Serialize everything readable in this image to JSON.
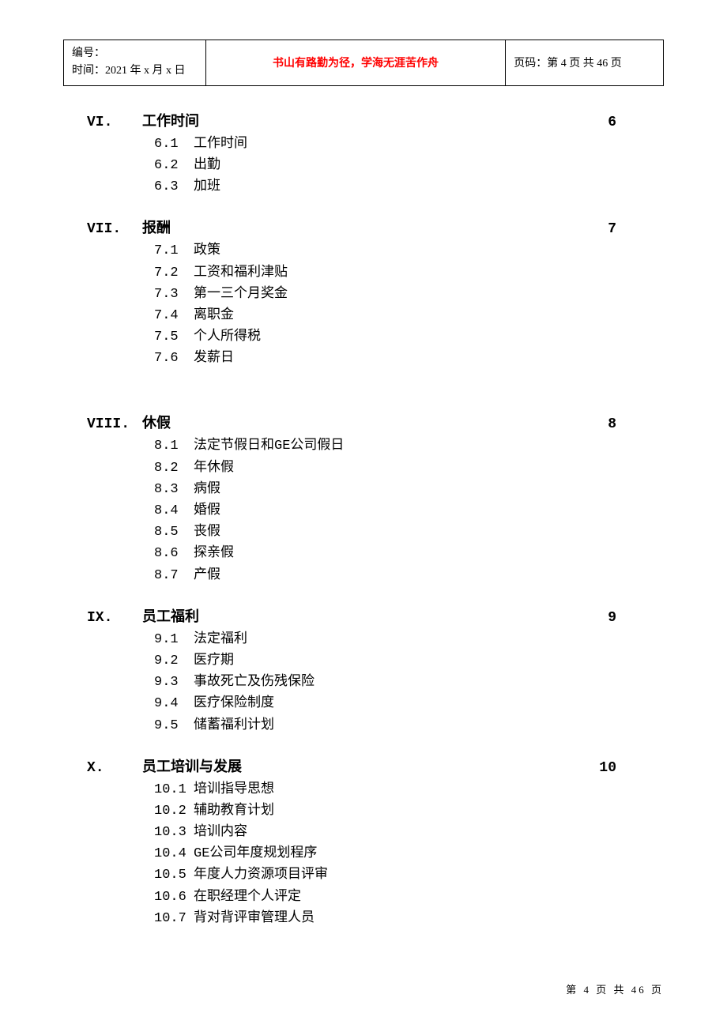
{
  "header": {
    "serial_label": "编号：",
    "time_label": "时间：2021 年 x 月 x 日",
    "motto": "书山有路勤为径，学海无涯苦作舟",
    "page_label": "页码：第 4 页 共 46 页"
  },
  "sections": [
    {
      "num": "VI.",
      "title": "工作时间",
      "page": "6",
      "items": [
        {
          "num": "6.1",
          "text": "工作时间"
        },
        {
          "num": "6.2",
          "text": "出勤"
        },
        {
          "num": "6.3",
          "text": "加班"
        }
      ],
      "extra_space_after": false
    },
    {
      "num": "VII.",
      "title": "报酬",
      "page": "7",
      "items": [
        {
          "num": "7.1",
          "text": "政策"
        },
        {
          "num": "7.2",
          "text": "工资和福利津贴"
        },
        {
          "num": "7.3",
          "text": "第一三个月奖金"
        },
        {
          "num": "7.4",
          "text": "离职金"
        },
        {
          "num": "7.5",
          "text": "个人所得税"
        },
        {
          "num": "7.6",
          "text": "发薪日"
        }
      ],
      "extra_space_after": true
    },
    {
      "num": "VIII.",
      "title": "休假",
      "page": "8",
      "items": [
        {
          "num": "8.1",
          "text": "法定节假日和GE公司假日"
        },
        {
          "num": "8.2",
          "text": "年休假"
        },
        {
          "num": "8.3",
          "text": "病假"
        },
        {
          "num": "8.4",
          "text": "婚假"
        },
        {
          "num": "8.5",
          "text": "丧假"
        },
        {
          "num": "8.6",
          "text": "探亲假"
        },
        {
          "num": "8.7",
          "text": "产假"
        }
      ],
      "extra_space_after": false
    },
    {
      "num": "IX.",
      "title": "员工福利",
      "page": "9",
      "items": [
        {
          "num": "9.1",
          "text": "法定福利"
        },
        {
          "num": "9.2",
          "text": "医疗期"
        },
        {
          "num": "9.3",
          "text": "事故死亡及伤残保险"
        },
        {
          "num": "9.4",
          "text": "医疗保险制度"
        },
        {
          "num": "9.5",
          "text": "储蓄福利计划"
        }
      ],
      "extra_space_after": false
    },
    {
      "num": "X.",
      "title": "员工培训与发展",
      "page": "10",
      "items": [
        {
          "num": "10.1",
          "text": "培训指导思想"
        },
        {
          "num": "10.2",
          "text": "辅助教育计划"
        },
        {
          "num": "10.3",
          "text": "培训内容"
        },
        {
          "num": "10.4",
          "text": "GE公司年度规划程序"
        },
        {
          "num": "10.5",
          "text": "年度人力资源项目评审"
        },
        {
          "num": "10.6",
          "text": "在职经理个人评定"
        },
        {
          "num": "10.7",
          "text": "背对背评审管理人员"
        }
      ],
      "extra_space_after": false
    }
  ],
  "footer": {
    "page_text": "第 4 页 共 46 页"
  }
}
